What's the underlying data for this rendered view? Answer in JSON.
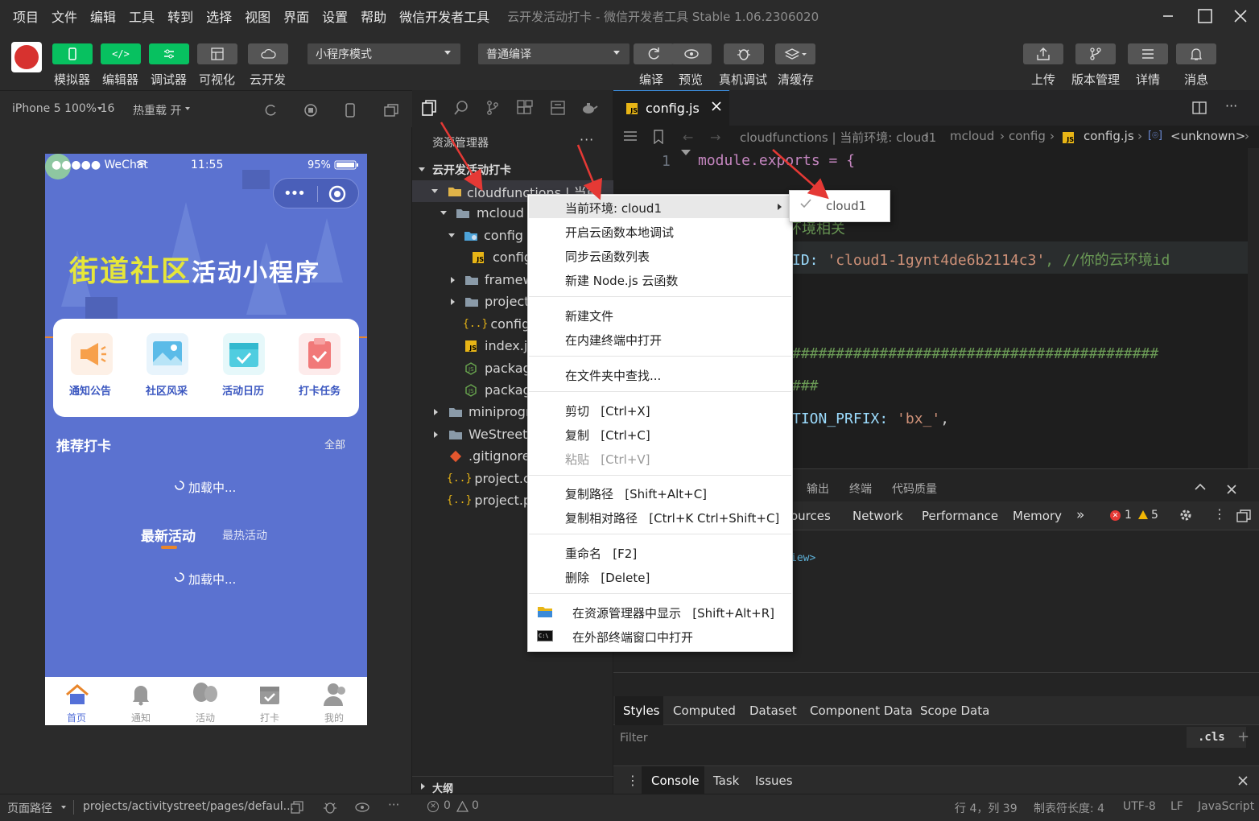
{
  "menubar": {
    "items": [
      "项目",
      "文件",
      "编辑",
      "工具",
      "转到",
      "选择",
      "视图",
      "界面",
      "设置",
      "帮助",
      "微信开发者工具"
    ],
    "title": "云开发活动打卡 - 微信开发者工具 Stable 1.06.2306020"
  },
  "toolbar": {
    "left_buttons": [
      "模拟器",
      "编辑器",
      "调试器",
      "可视化",
      "云开发"
    ],
    "mode_select": "小程序模式",
    "compile_select": "普通编译",
    "mid_buttons": [
      "编译",
      "预览",
      "真机调试",
      "清缓存"
    ],
    "right_buttons": [
      "上传",
      "版本管理",
      "详情",
      "消息"
    ]
  },
  "simulator": {
    "device": "iPhone 5 100% 16",
    "hotreload": "热重载 开",
    "status_left": "●●●●● WeChat",
    "status_time": "11:55",
    "status_battery": "95%",
    "banner_part1": "街道社区",
    "banner_part2": "活动小程序",
    "quick": [
      "通知公告",
      "社区风采",
      "活动日历",
      "打卡任务"
    ],
    "section_title": "推荐打卡",
    "section_more": "全部",
    "loading": "加载中...",
    "tab_active": "最新活动",
    "tab_other": "最热活动",
    "tabbar": [
      "首页",
      "通知",
      "活动",
      "打卡",
      "我的"
    ]
  },
  "explorer": {
    "title": "资源管理器",
    "project": "云开发活动打卡",
    "items": [
      {
        "label": "cloudfunctions | 当前...",
        "indent": 1
      },
      {
        "label": "mcloud",
        "indent": 2
      },
      {
        "label": "config",
        "indent": 3
      },
      {
        "label": "config",
        "indent": 4
      },
      {
        "label": "framew",
        "indent": 3
      },
      {
        "label": "project",
        "indent": 3
      },
      {
        "label": "config.j",
        "indent": 3
      },
      {
        "label": "index.js",
        "indent": 3
      },
      {
        "label": "packag",
        "indent": 3
      },
      {
        "label": "packag",
        "indent": 3
      },
      {
        "label": "miniprogr",
        "indent": 1
      },
      {
        "label": "WeStreet-",
        "indent": 1
      },
      {
        "label": ".gitignore",
        "indent": 1
      },
      {
        "label": "project.co",
        "indent": 1
      },
      {
        "label": "project.pri",
        "indent": 1
      }
    ],
    "outline": "大纲",
    "problems_errors": "0",
    "problems_warnings": "0"
  },
  "editor": {
    "tab": "config.js",
    "breadcrumb": [
      "cloudfunctions | 当前环境: cloud1",
      "mcloud",
      "config",
      "config.js",
      "<unknown>"
    ],
    "line1": "module.exports = {",
    "line_env_comment": "环境相关",
    "line_id_key": "ID: ",
    "line_id_value": "'cloud1-1gynt4de6b2114c3'",
    "line_id_comment": ", //你的云环境id",
    "line_hash1": "##########################################",
    "line_hash2": "###",
    "line_prefix_key": "TION_PRFIX: ",
    "line_prefix_value": "'bx_'",
    "line_prefix_end": ","
  },
  "devtools": {
    "panel_tabs": [
      "输出",
      "终端",
      "代码质量"
    ],
    "tabs": [
      "ources",
      "Network",
      "Performance",
      "Memory"
    ],
    "errors": "1",
    "warnings": "5",
    "dom_snippet": "iew>",
    "style_tabs": [
      "Styles",
      "Computed",
      "Dataset",
      "Component Data",
      "Scope Data"
    ],
    "filter_placeholder": "Filter",
    "cls": ".cls",
    "console_tabs": [
      "Console",
      "Task",
      "Issues"
    ]
  },
  "context_menu": {
    "groups": [
      [
        "当前环境: cloud1",
        "开启云函数本地调试",
        "同步云函数列表",
        "新建 Node.js 云函数"
      ],
      [
        "新建文件",
        "在内建终端中打开"
      ],
      [
        "在文件夹中查找..."
      ],
      [
        "剪切   [Ctrl+X]",
        "复制   [Ctrl+C]",
        "粘贴   [Ctrl+V]"
      ],
      [
        "复制路径   [Shift+Alt+C]",
        "复制相对路径   [Ctrl+K Ctrl+Shift+C]"
      ],
      [
        "重命名   [F2]",
        "删除   [Delete]"
      ],
      [
        "在资源管理器中显示   [Shift+Alt+R]",
        "在外部终端窗口中打开"
      ]
    ],
    "submenu": "cloud1"
  },
  "statusbar": {
    "page_path_label": "页面路径",
    "page_path": "projects/activitystreet/pages/defaul...",
    "position": "行 4，列 39",
    "tab_size": "制表符长度: 4",
    "encoding": "UTF-8",
    "eol": "LF",
    "language": "JavaScript"
  },
  "colors": {
    "accent_green": "#07c160",
    "phone_bg": "#5b72d0",
    "annotation_red": "#e53935"
  }
}
